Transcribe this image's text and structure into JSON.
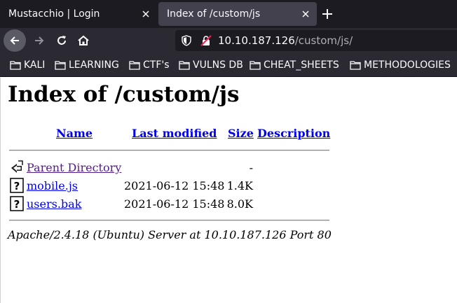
{
  "browser": {
    "tabs": [
      {
        "title": "Mustacchio | Login",
        "active": false
      },
      {
        "title": "Index of /custom/js",
        "active": true
      }
    ],
    "url": {
      "host": "10.10.187.126",
      "path": "/custom/js/"
    },
    "bookmarks": [
      "KALI",
      "LEARNING",
      "CTF's",
      "VULNS DB",
      "CHEAT_SHEETS",
      "METHODOLOGIES"
    ]
  },
  "page": {
    "title": "Index of /custom/js",
    "columns": {
      "name": "Name",
      "last_modified": "Last modified",
      "size": "Size",
      "description": "Description"
    },
    "rows": [
      {
        "name": "Parent Directory",
        "modified": "",
        "size": "-",
        "icon": "back-folder-icon"
      },
      {
        "name": "mobile.js",
        "modified": "2021-06-12 15:48",
        "size": "1.4K",
        "icon": "unknown-file-icon"
      },
      {
        "name": "users.bak",
        "modified": "2021-06-12 15:48",
        "size": "8.0K",
        "icon": "unknown-file-icon"
      }
    ],
    "server_signature": "Apache/2.4.18 (Ubuntu) Server at 10.10.187.126 Port 80"
  },
  "colors": {
    "tab_bar": "#1c1b22",
    "toolbar": "#2b2a33",
    "active_tab": "#42414d",
    "link": "#0000ee",
    "visited_link": "#551a8b"
  }
}
